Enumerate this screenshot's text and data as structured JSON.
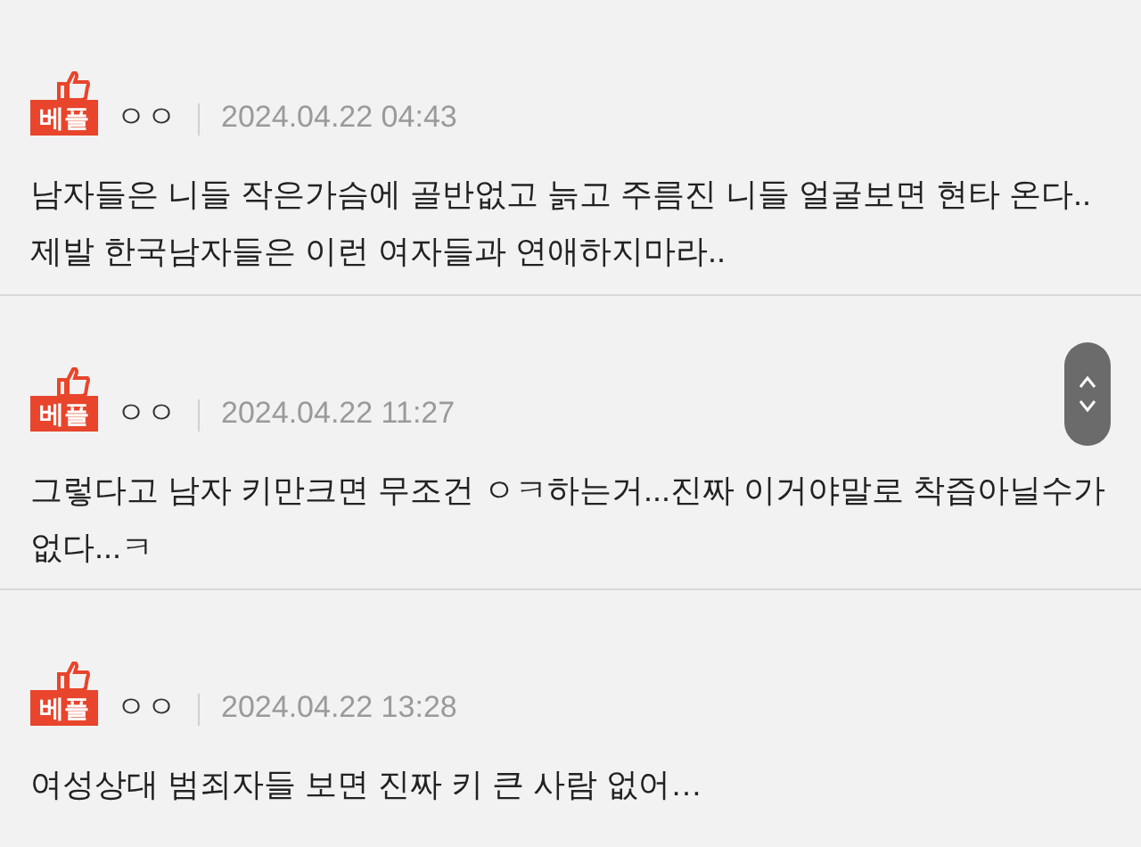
{
  "comments": [
    {
      "badge": "베플",
      "author": "ㅇㅇ",
      "date": "2024.04.22 04:43",
      "text": "남자들은 니들 작은가슴에 골반없고 늙고 주름진 니들 얼굴보면 현타 온다.. 제발 한국남자들은 이런 여자들과 연애하지마라.."
    },
    {
      "badge": "베플",
      "author": "ㅇㅇ",
      "date": "2024.04.22 11:27",
      "text": "그렇다고 남자 키만크면 무조건 ㅇㅋ하는거...진짜 이거야말로 착즙아닐수가 없다...ㅋ"
    },
    {
      "badge": "베플",
      "author": "ㅇㅇ",
      "date": "2024.04.22 13:28",
      "text": "여성상대 범죄자들 보면 진짜 키 큰 사람 없어…"
    }
  ]
}
